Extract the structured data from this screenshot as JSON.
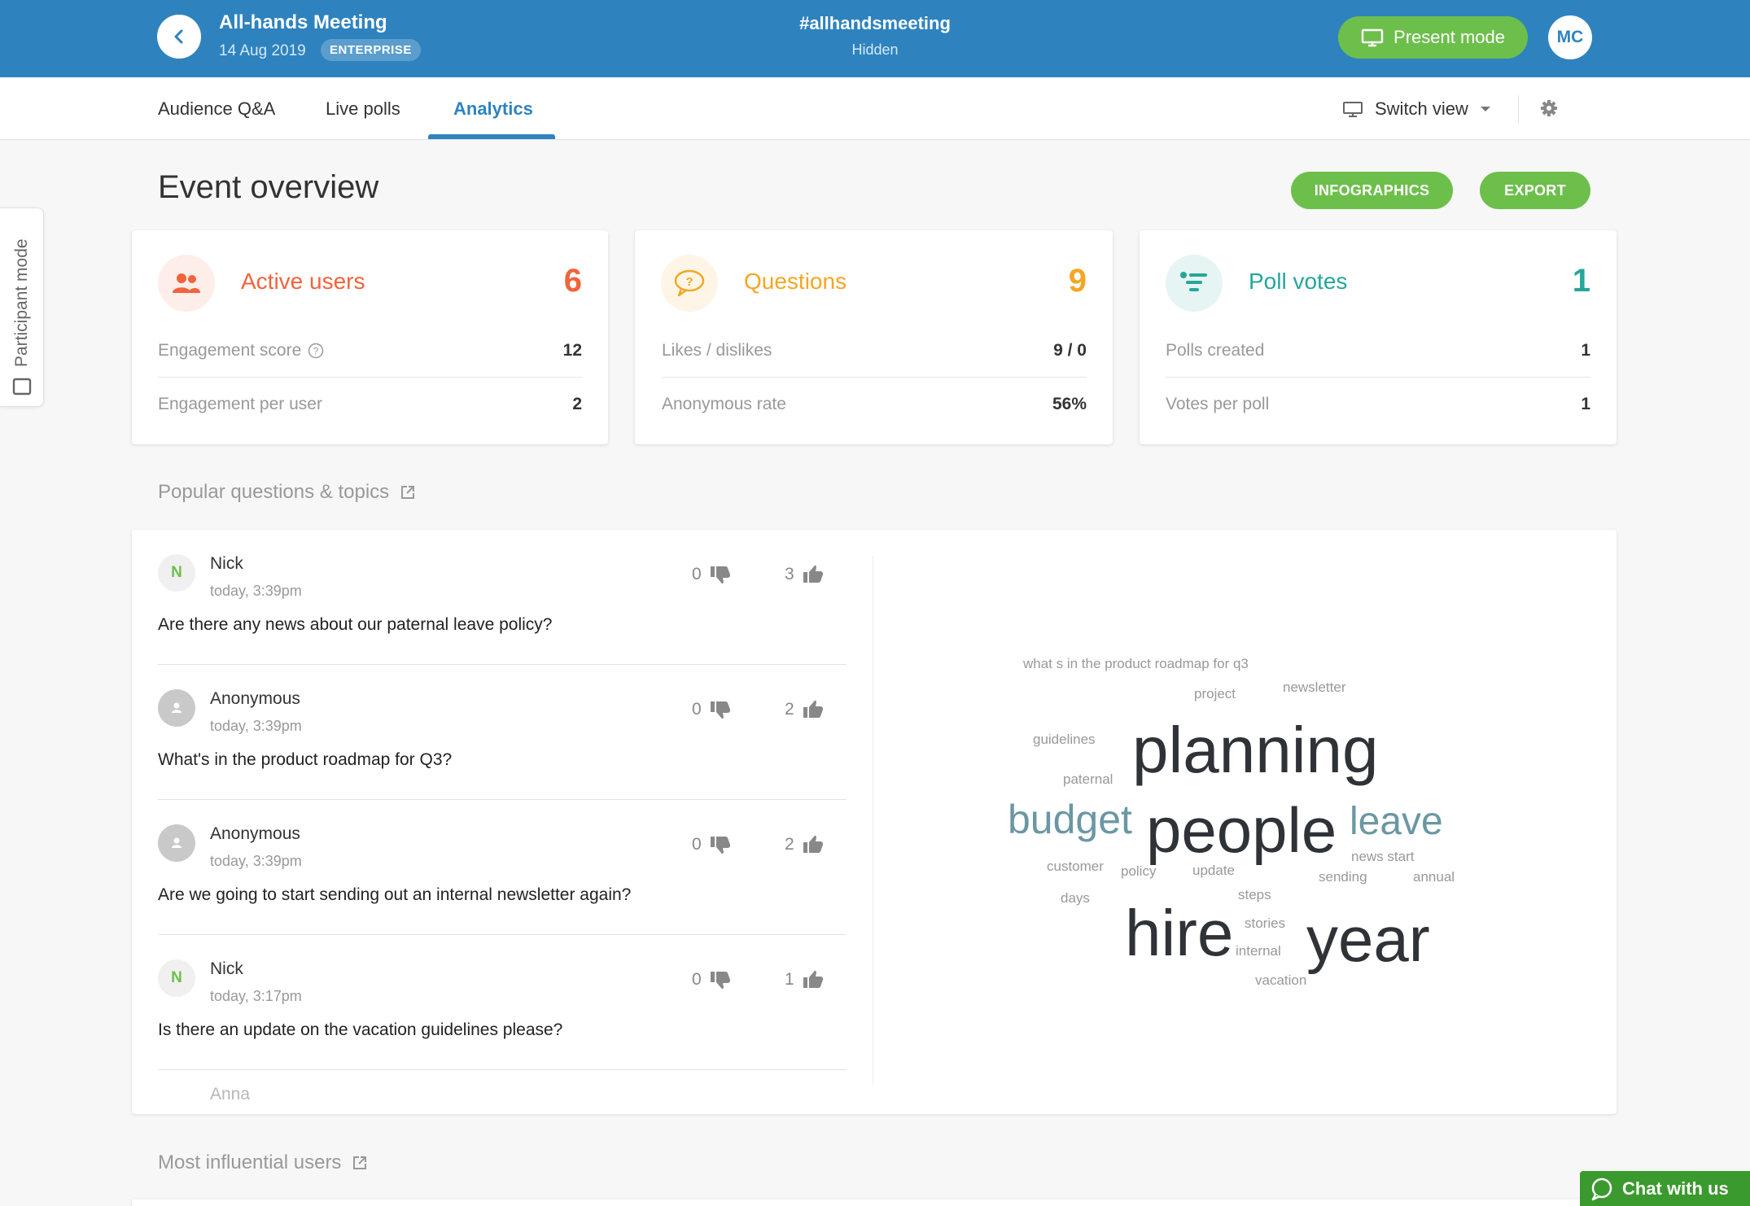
{
  "header": {
    "event_title": "All-hands Meeting",
    "event_date": "14 Aug 2019",
    "plan_badge": "ENTERPRISE",
    "hashtag": "#allhandsmeeting",
    "visibility": "Hidden",
    "present_label": "Present mode",
    "user_initials": "MC"
  },
  "tabs": [
    {
      "label": "Audience Q&A"
    },
    {
      "label": "Live polls"
    },
    {
      "label": "Analytics"
    }
  ],
  "toolbar": {
    "switch_view_label": "Switch view"
  },
  "side_tab": {
    "label": "Participant mode"
  },
  "overview": {
    "title": "Event overview",
    "infographics_label": "INFOGRAPHICS",
    "export_label": "EXPORT",
    "cards": [
      {
        "title": "Active users",
        "value": "6",
        "color": "#f0643c",
        "rows": [
          {
            "label": "Engagement score",
            "value": "12"
          },
          {
            "label": "Engagement per user",
            "value": "2"
          }
        ]
      },
      {
        "title": "Questions",
        "value": "9",
        "color": "#f5a623",
        "rows": [
          {
            "label": "Likes / dislikes",
            "value": "9 / 0"
          },
          {
            "label": "Anonymous rate",
            "value": "56%"
          }
        ]
      },
      {
        "title": "Poll votes",
        "value": "1",
        "color": "#26a69a",
        "rows": [
          {
            "label": "Polls created",
            "value": "1"
          },
          {
            "label": "Votes per poll",
            "value": "1"
          }
        ]
      }
    ]
  },
  "popular": {
    "title": "Popular questions & topics",
    "questions": [
      {
        "initial": "N",
        "author": "Nick",
        "time": "today, 3:39pm",
        "text": "Are there any news about our paternal leave policy?",
        "dislikes": "0",
        "likes": "3"
      },
      {
        "initial": "",
        "author": "Anonymous",
        "time": "today, 3:39pm",
        "text": "What's in the product roadmap for Q3?",
        "dislikes": "0",
        "likes": "2"
      },
      {
        "initial": "",
        "author": "Anonymous",
        "time": "today, 3:39pm",
        "text": "Are we going to start sending out an internal newsletter again?",
        "dislikes": "0",
        "likes": "2"
      },
      {
        "initial": "N",
        "author": "Nick",
        "time": "today, 3:17pm",
        "text": "Is there an update on the vacation guidelines please?",
        "dislikes": "0",
        "likes": "1"
      },
      {
        "initial": "",
        "author": "Anna",
        "time": "",
        "text": "",
        "dislikes": "",
        "likes": ""
      }
    ],
    "word_cloud": [
      "what s in the product roadmap for q3",
      "project",
      "newsletter",
      "guidelines",
      "planning",
      "paternal",
      "budget",
      "people",
      "leave",
      "customer",
      "policy",
      "update",
      "news start",
      "sending",
      "annual",
      "days",
      "steps",
      "stories",
      "hire",
      "year",
      "internal",
      "vacation"
    ]
  },
  "influential": {
    "title": "Most influential users"
  },
  "chat": {
    "label": "Chat with us"
  }
}
